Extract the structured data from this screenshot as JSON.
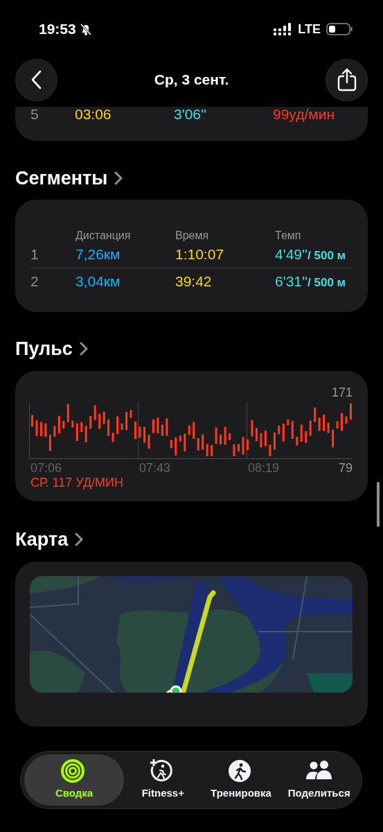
{
  "status_bar": {
    "time": "19:53",
    "silent": true,
    "network": "LTE"
  },
  "nav": {
    "title": "Ср, 3 сент."
  },
  "splits_rows": [
    {
      "index": "5",
      "time": "03:06",
      "pace": "3'06''",
      "heart_rate": "99уд/мин"
    }
  ],
  "segments": {
    "title": "Сегменты",
    "columns": [
      "Дистанция",
      "Время",
      "Темп"
    ],
    "rows": [
      {
        "index": "1",
        "distance": "7,26км",
        "time": "1:10:07",
        "pace": "4'49''",
        "pace_unit": "/ 500 м"
      },
      {
        "index": "2",
        "distance": "3,04км",
        "time": "39:42",
        "pace": "6'31''",
        "pace_unit": "/ 500 м"
      }
    ]
  },
  "heart_rate": {
    "title": "Пульс",
    "max_label": "171",
    "min_label": "79",
    "time_labels": [
      "07:06",
      "07:43",
      "08:19"
    ],
    "average": "СР. 117 УД/МИН"
  },
  "map": {
    "title": "Карта"
  },
  "tab_bar": [
    {
      "kind": "rings",
      "label": "Сводка",
      "selected": true
    },
    {
      "kind": "fitness",
      "label": "Fitness+",
      "selected": false
    },
    {
      "kind": "workout",
      "label": "Тренировка",
      "selected": false
    },
    {
      "kind": "share",
      "label": "Поделиться",
      "selected": false
    }
  ]
}
